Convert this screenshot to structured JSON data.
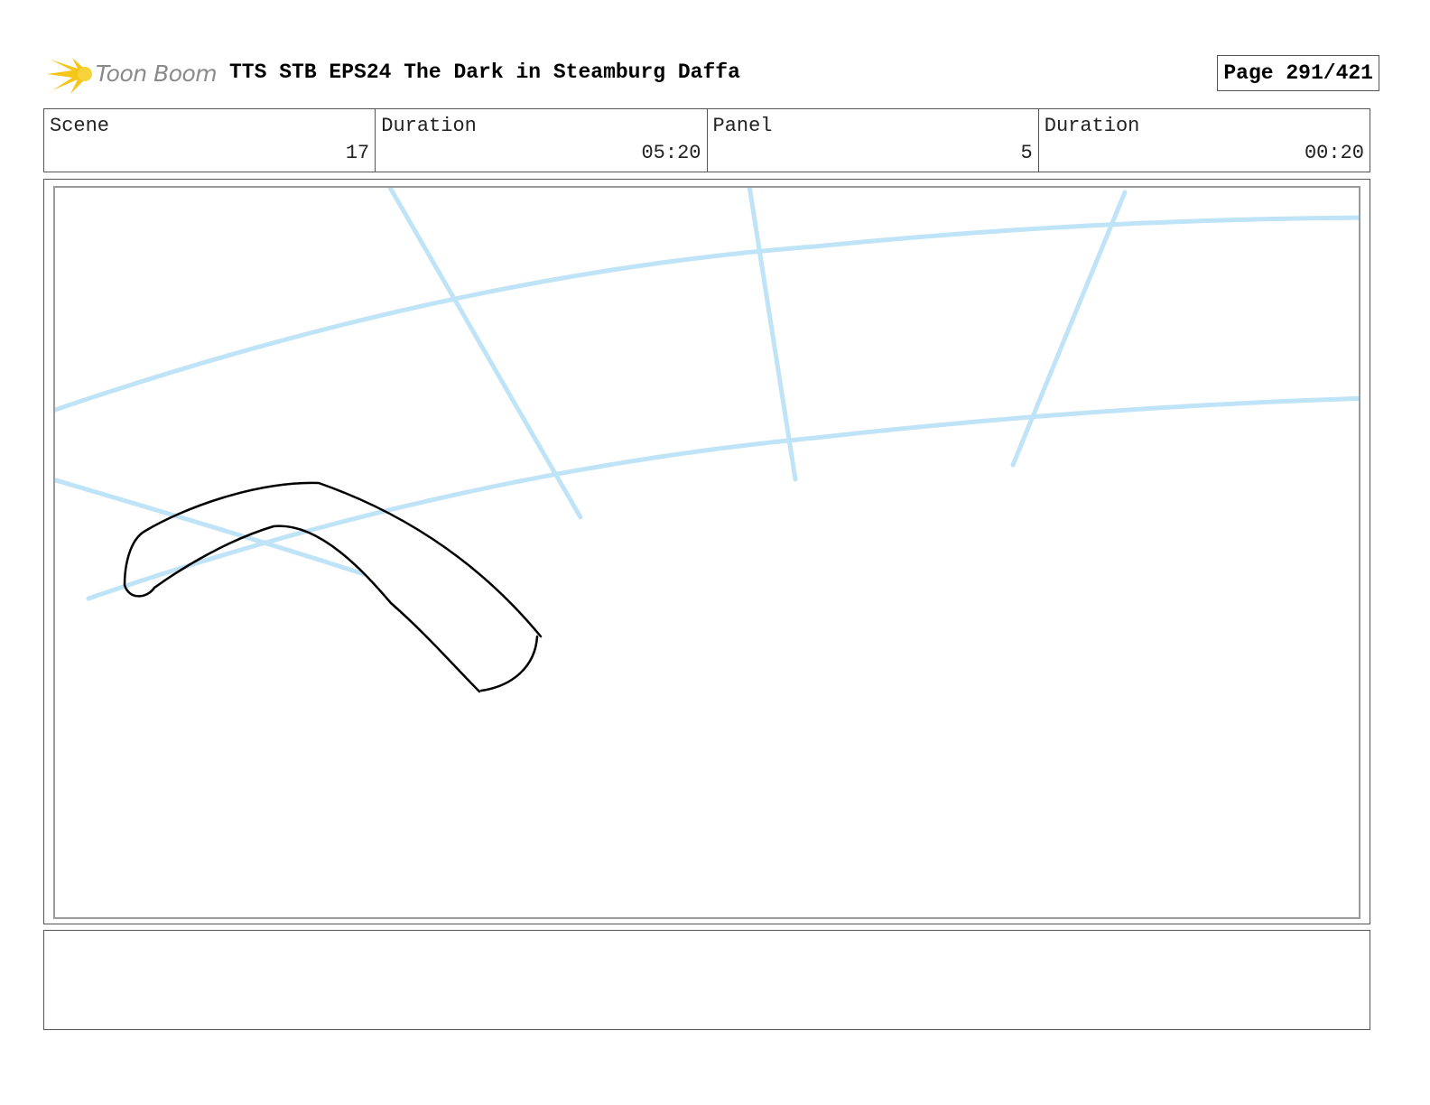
{
  "header": {
    "logo_text": "Toon Boom",
    "doc_title": "TTS STB EPS24 The Dark in Steamburg Daffa",
    "page_label": "Page 291/421"
  },
  "info": {
    "scene_label": "Scene",
    "scene_value": "17",
    "scene_duration_label": "Duration",
    "scene_duration_value": "05:20",
    "panel_label": "Panel",
    "panel_value": "5",
    "panel_duration_label": "Duration",
    "panel_duration_value": "00:20"
  },
  "colors": {
    "guide_lines": "#bfe3f7",
    "sketch_lines": "#000000",
    "logo_yellow": "#f5c518"
  },
  "notes": {
    "text": ""
  }
}
